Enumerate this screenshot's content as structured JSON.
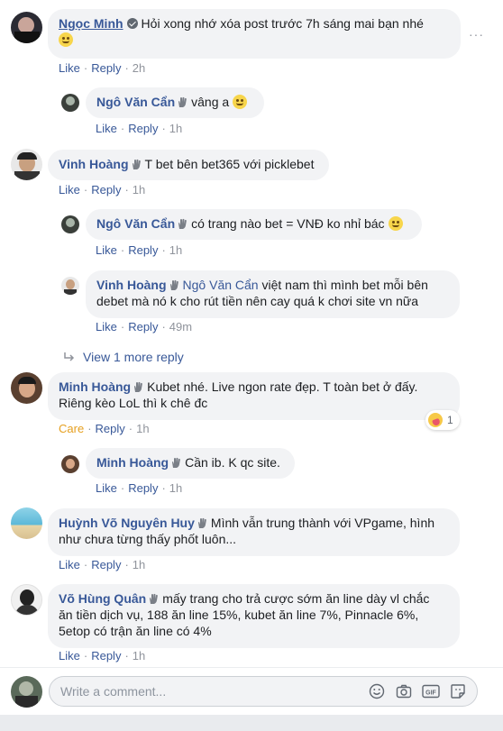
{
  "actions": {
    "like": "Like",
    "reply": "Reply",
    "care": "Care"
  },
  "comments": [
    {
      "name": "Ngọc Minh",
      "text": "Hỏi xong nhớ xóa post trước 7h sáng mai bạn nhé",
      "time": "2h"
    },
    {
      "name": "Ngô Văn Cẩn",
      "text": "vâng a",
      "time": "1h"
    },
    {
      "name": "Vinh Hoàng",
      "text": "T bet bên bet365 với picklebet",
      "time": "1h"
    },
    {
      "name": "Ngô Văn Cẩn",
      "text": "có trang nào bet = VNĐ ko nhỉ bác",
      "time": "1h"
    },
    {
      "name": "Vinh Hoàng",
      "mention": "Ngô Văn Cẩn",
      "text_line1": "việt nam thì mình bet mỗi bên",
      "text_line2": "debet mà nó k cho rút tiền nên cay quá k chơi site vn nữa",
      "time": "49m"
    },
    {
      "name": "Minh Hoàng",
      "text_line1": "Kubet nhé. Live ngon rate đẹp. T toàn bet ở đấy.",
      "text_line2": "Riêng kèo LoL thì k chê đc",
      "time": "1h",
      "reaction_count": "1"
    },
    {
      "name": "Minh Hoàng",
      "text": "Cần ib. K qc site.",
      "time": "1h"
    },
    {
      "name": "Huỳnh Võ Nguyên Huy",
      "text_line1": "Mình vẫn trung thành với VPgame, hình",
      "text_line2": "như chưa từng thấy phốt luôn...",
      "time": "1h"
    },
    {
      "name": "Võ Hùng Quân",
      "text_line1": "mấy trang cho trả cược sớm ăn line dày vl chắc",
      "text_line2": "ăn tiền dịch vụ, 188 ăn line 15%, kubet ăn line 7%, Pinnacle 6%,",
      "text_line3": "5etop có trận ăn line có 4%",
      "time": "1h"
    }
  ],
  "view_more": "View 1 more reply",
  "composer": {
    "placeholder": "Write a comment..."
  },
  "icons": [
    "verified-icon",
    "more-options-icon",
    "wave-badge-icon",
    "emoji-icon",
    "reply-arrow-icon",
    "care-reaction-icon",
    "camera-icon",
    "gif-icon",
    "sticker-icon"
  ]
}
